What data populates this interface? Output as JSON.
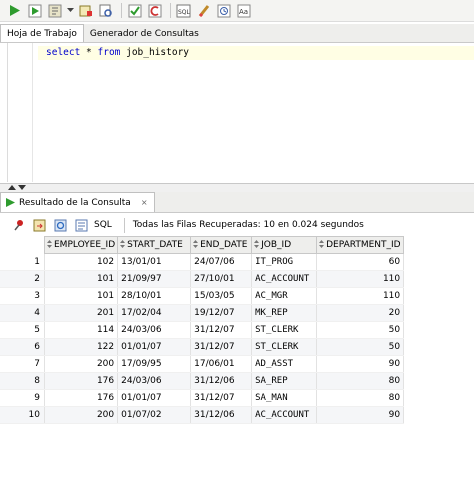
{
  "toolbar": {
    "icons": [
      "run-statement-icon",
      "run-script-icon",
      "autotrace-icon",
      "explain-plan-icon",
      "sql-tuning-icon",
      "commit-icon",
      "rollback-icon",
      "unshared-sql-icon",
      "clear-icon",
      "history-icon",
      "format-icon"
    ]
  },
  "worksheet": {
    "tabs": [
      "Hoja de Trabajo",
      "Generador de Consultas"
    ],
    "sql_keyword_select": "select",
    "sql_star": " * ",
    "sql_keyword_from": "from",
    "sql_table": " job_history"
  },
  "results": {
    "tab_label": "Resultado de la Consulta",
    "tab_close": "×",
    "sql_label": "SQL",
    "status": "Todas las Filas Recuperadas: 10 en 0.024 segundos",
    "columns": [
      "EMPLOYEE_ID",
      "START_DATE",
      "END_DATE",
      "JOB_ID",
      "DEPARTMENT_ID"
    ],
    "rows": [
      {
        "n": "1",
        "employee_id": "102",
        "start_date": "13/01/01",
        "end_date": "24/07/06",
        "job_id": "IT_PROG",
        "department_id": "60"
      },
      {
        "n": "2",
        "employee_id": "101",
        "start_date": "21/09/97",
        "end_date": "27/10/01",
        "job_id": "AC_ACCOUNT",
        "department_id": "110"
      },
      {
        "n": "3",
        "employee_id": "101",
        "start_date": "28/10/01",
        "end_date": "15/03/05",
        "job_id": "AC_MGR",
        "department_id": "110"
      },
      {
        "n": "4",
        "employee_id": "201",
        "start_date": "17/02/04",
        "end_date": "19/12/07",
        "job_id": "MK_REP",
        "department_id": "20"
      },
      {
        "n": "5",
        "employee_id": "114",
        "start_date": "24/03/06",
        "end_date": "31/12/07",
        "job_id": "ST_CLERK",
        "department_id": "50"
      },
      {
        "n": "6",
        "employee_id": "122",
        "start_date": "01/01/07",
        "end_date": "31/12/07",
        "job_id": "ST_CLERK",
        "department_id": "50"
      },
      {
        "n": "7",
        "employee_id": "200",
        "start_date": "17/09/95",
        "end_date": "17/06/01",
        "job_id": "AD_ASST",
        "department_id": "90"
      },
      {
        "n": "8",
        "employee_id": "176",
        "start_date": "24/03/06",
        "end_date": "31/12/06",
        "job_id": "SA_REP",
        "department_id": "80"
      },
      {
        "n": "9",
        "employee_id": "176",
        "start_date": "01/01/07",
        "end_date": "31/12/07",
        "job_id": "SA_MAN",
        "department_id": "80"
      },
      {
        "n": "10",
        "employee_id": "200",
        "start_date": "01/07/02",
        "end_date": "31/12/06",
        "job_id": "AC_ACCOUNT",
        "department_id": "90"
      }
    ]
  },
  "colors": {
    "keyword": "#0000cc",
    "run_green": "#2e9b2e",
    "pin_red": "#cc2222"
  }
}
